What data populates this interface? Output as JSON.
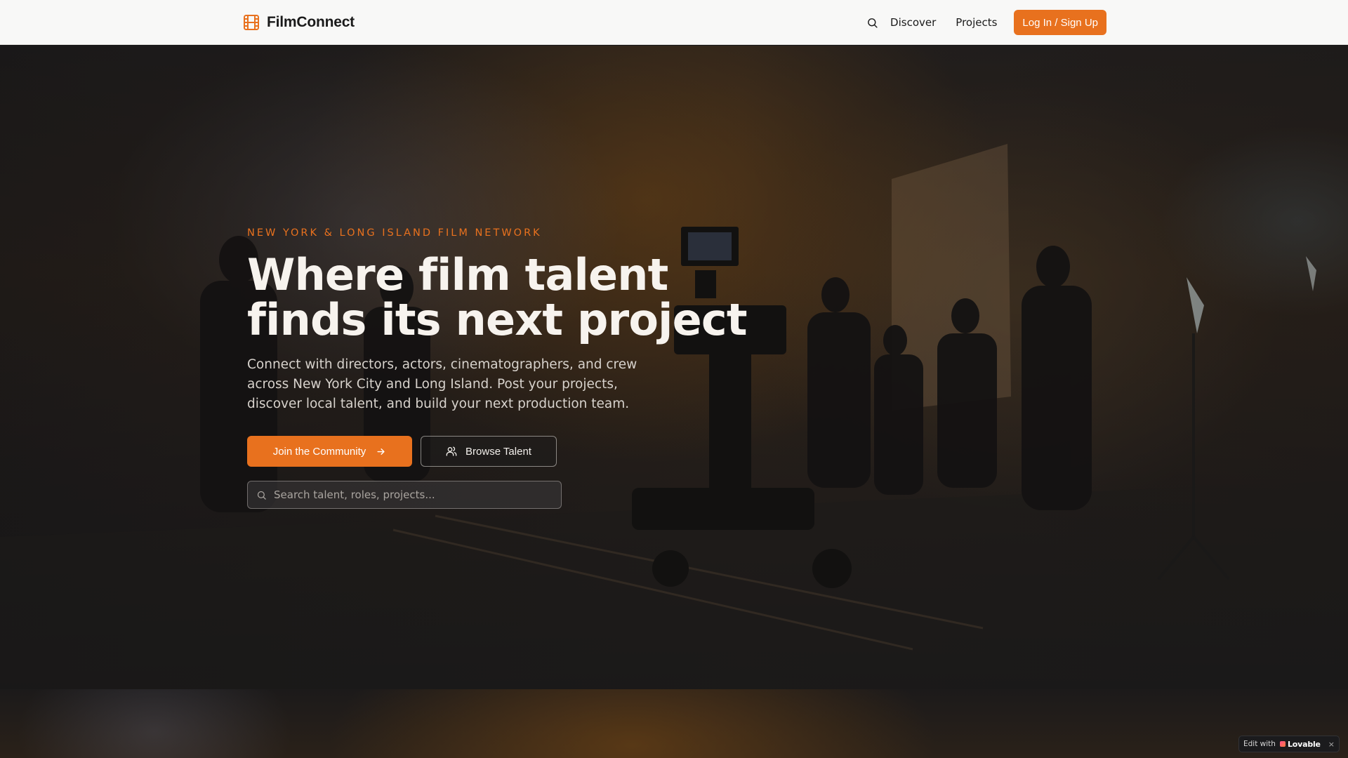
{
  "header": {
    "brand_name": "FilmConnect",
    "brand_icon": "film-icon",
    "search_icon": "search-icon",
    "nav_items": [
      "Discover",
      "Projects"
    ],
    "cta_label": "Log In / Sign Up"
  },
  "hero": {
    "eyebrow": "NEW YORK & LONG ISLAND FILM NETWORK",
    "headline_line1": "Where film talent",
    "headline_line2": "finds its next project",
    "lede": "Connect with directors, actors, cinematographers, and crew across New York City and Long Island. Post your projects, discover local talent, and build your next production team.",
    "primary_button": "Join the Community",
    "primary_button_icon": "arrow-right-icon",
    "secondary_button": "Browse Talent",
    "secondary_button_icon": "users-icon",
    "search_placeholder": "Search talent, roles, projects..."
  },
  "badge": {
    "prefix": "Edit with",
    "brand": "Lovable",
    "close": "×"
  },
  "colors": {
    "accent": "#e8711e",
    "header_bg": "#f8f8f7",
    "hero_text": "#f7f3ee"
  }
}
